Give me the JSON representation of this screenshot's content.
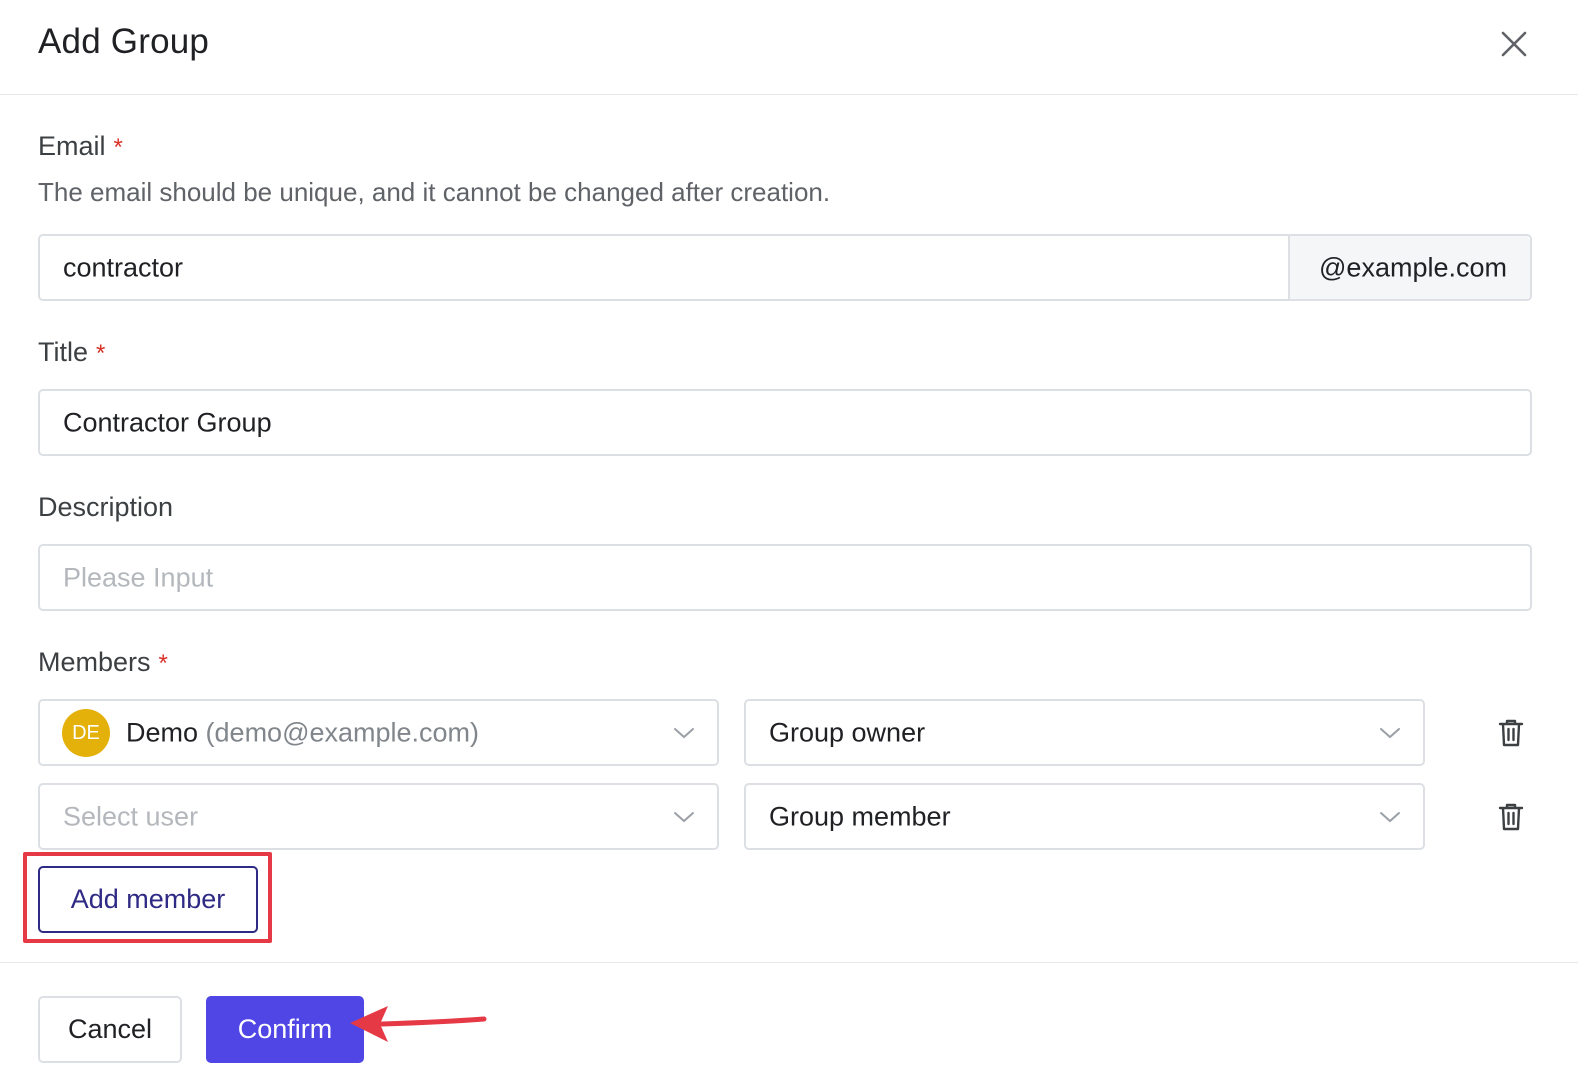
{
  "dialog": {
    "title": "Add Group"
  },
  "email": {
    "label": "Email",
    "required_mark": "*",
    "hint": "The email should be unique, and it cannot be changed after creation.",
    "value": "contractor",
    "suffix": "@example.com"
  },
  "title_field": {
    "label": "Title",
    "required_mark": "*",
    "value": "Contractor Group"
  },
  "description": {
    "label": "Description",
    "placeholder": "Please Input",
    "value": ""
  },
  "members": {
    "label": "Members",
    "required_mark": "*",
    "rows": [
      {
        "avatar_initials": "DE",
        "name": "Demo",
        "email": "(demo@example.com)",
        "role": "Group owner"
      },
      {
        "user_placeholder": "Select user",
        "role": "Group member"
      }
    ],
    "add_label": "Add member"
  },
  "footer": {
    "cancel_label": "Cancel",
    "confirm_label": "Confirm"
  },
  "colors": {
    "accent": "#4f46e5",
    "annotation": "#e63946",
    "avatar": "#e4b10b",
    "required": "#d93025"
  },
  "icons": {
    "close": "close-icon",
    "chevron": "chevron-down-icon",
    "delete": "trash-icon"
  }
}
